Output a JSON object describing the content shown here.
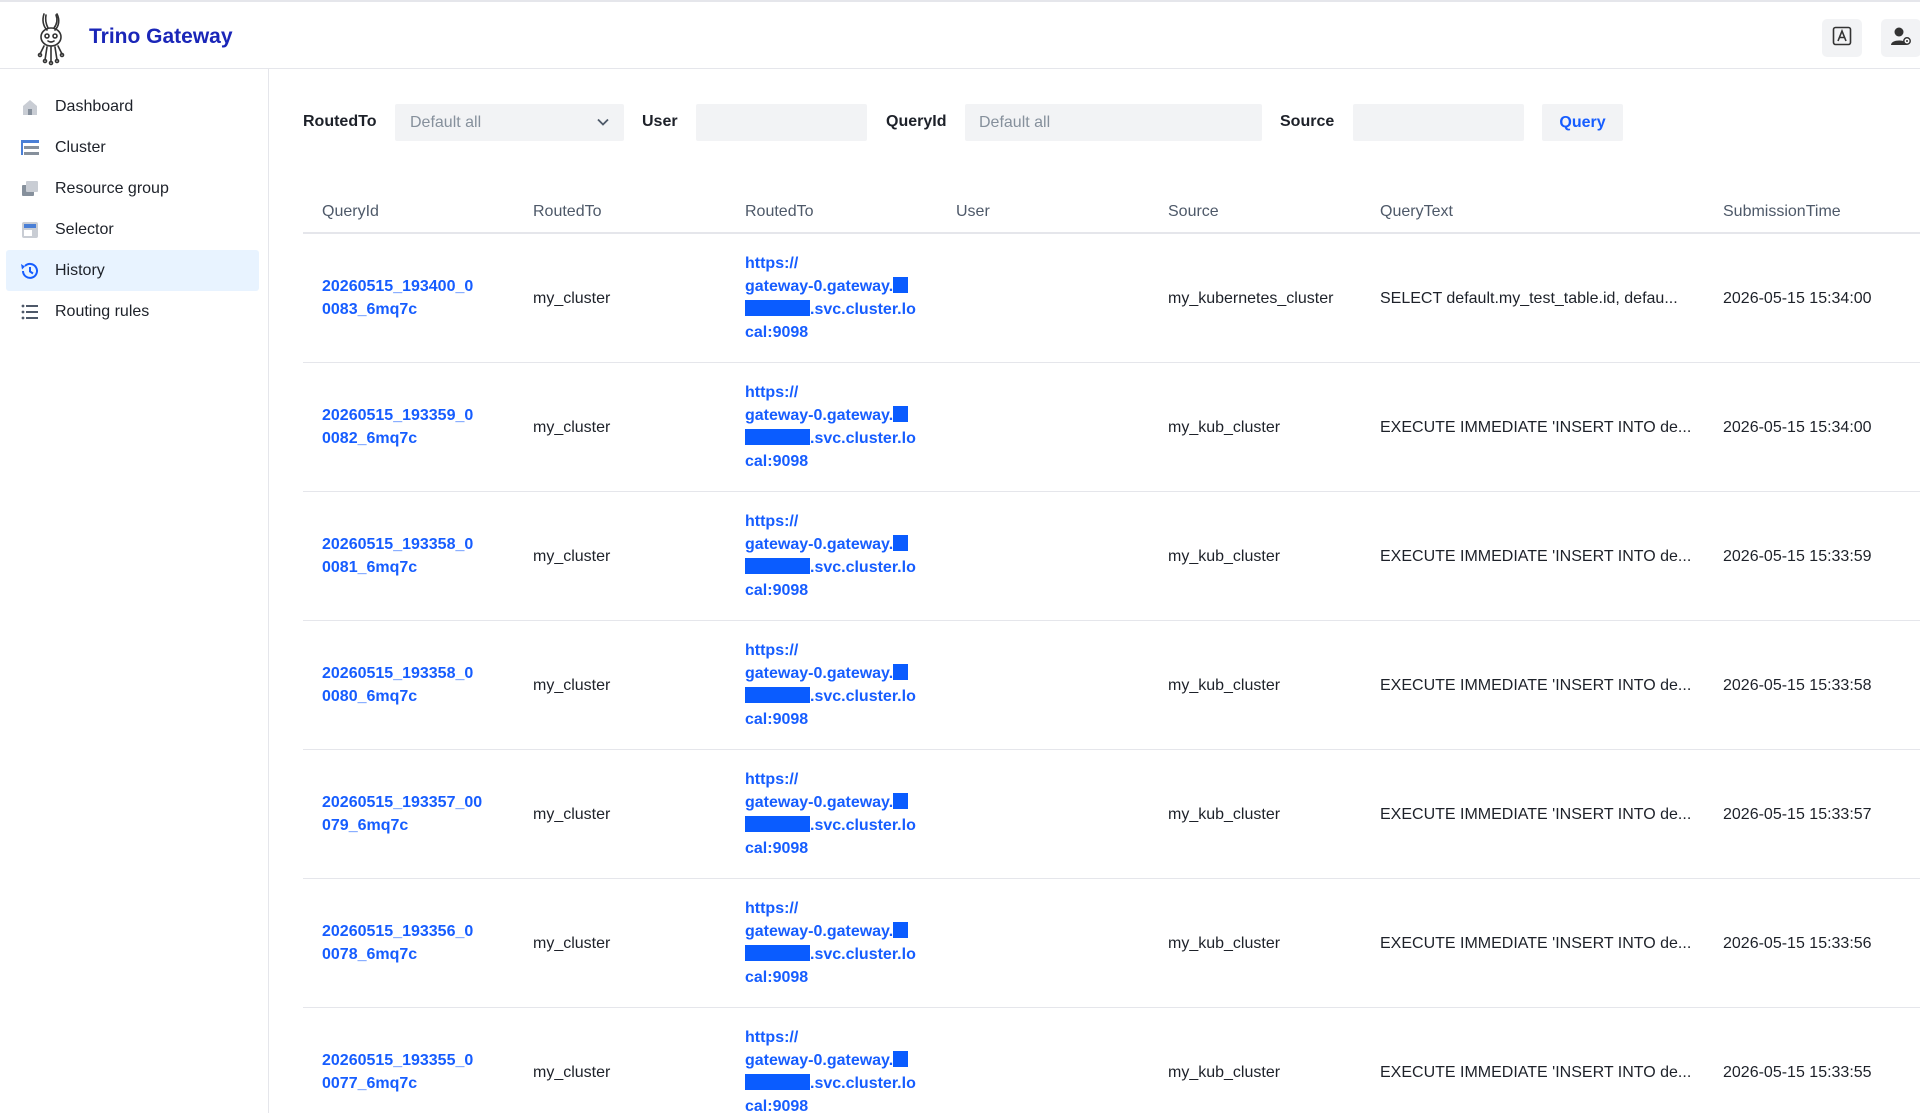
{
  "header": {
    "app_title": "Trino Gateway",
    "logo_icon": "trino-bunny-logo",
    "translate_icon": "translate-icon",
    "user_settings_icon": "user-settings-icon"
  },
  "sidebar": {
    "items": [
      {
        "label": "Dashboard",
        "icon": "home-icon",
        "active": false
      },
      {
        "label": "Cluster",
        "icon": "cluster-icon",
        "active": false
      },
      {
        "label": "Resource group",
        "icon": "resource-group-icon",
        "active": false
      },
      {
        "label": "Selector",
        "icon": "selector-icon",
        "active": false
      },
      {
        "label": "History",
        "icon": "history-icon",
        "active": true
      },
      {
        "label": "Routing rules",
        "icon": "list-icon",
        "active": false
      }
    ]
  },
  "filters": {
    "routed_to_label": "RoutedTo",
    "routed_to_placeholder": "Default all",
    "user_label": "User",
    "user_value": "",
    "query_id_label": "QueryId",
    "query_id_placeholder": "Default all",
    "source_label": "Source",
    "source_value": "",
    "query_button": "Query"
  },
  "table": {
    "columns": [
      "QueryId",
      "RoutedTo",
      "RoutedTo",
      "User",
      "Source",
      "QueryText",
      "SubmissionTime"
    ],
    "url_parts": {
      "line1": "https://",
      "line2": "gateway-0.gateway.",
      "line3_suffix": ".svc.cluster.lo",
      "line4": "cal:9098"
    },
    "rows": [
      {
        "qid1": "20260515_193400_0",
        "qid2": "0083_6mq7c",
        "cluster": "my_cluster",
        "user": "",
        "source": "my_kubernetes_cluster",
        "query_text": "SELECT default.my_test_table.id, defau...",
        "time": "2026-05-15 15:34:00"
      },
      {
        "qid1": "20260515_193359_0",
        "qid2": "0082_6mq7c",
        "cluster": "my_cluster",
        "user": "",
        "source": "my_kub_cluster",
        "query_text": "EXECUTE IMMEDIATE 'INSERT INTO de...",
        "time": "2026-05-15 15:34:00"
      },
      {
        "qid1": "20260515_193358_0",
        "qid2": "0081_6mq7c",
        "cluster": "my_cluster",
        "user": "",
        "source": "my_kub_cluster",
        "query_text": "EXECUTE IMMEDIATE 'INSERT INTO de...",
        "time": "2026-05-15 15:33:59"
      },
      {
        "qid1": "20260515_193358_0",
        "qid2": "0080_6mq7c",
        "cluster": "my_cluster",
        "user": "",
        "source": "my_kub_cluster",
        "query_text": "EXECUTE IMMEDIATE 'INSERT INTO de...",
        "time": "2026-05-15 15:33:58"
      },
      {
        "qid1": "20260515_193357_00",
        "qid2": "079_6mq7c",
        "cluster": "my_cluster",
        "user": "",
        "source": "my_kub_cluster",
        "query_text": "EXECUTE IMMEDIATE 'INSERT INTO de...",
        "time": "2026-05-15 15:33:57"
      },
      {
        "qid1": "20260515_193356_0",
        "qid2": "0078_6mq7c",
        "cluster": "my_cluster",
        "user": "",
        "source": "my_kub_cluster",
        "query_text": "EXECUTE IMMEDIATE 'INSERT INTO de...",
        "time": "2026-05-15 15:33:56"
      },
      {
        "qid1": "20260515_193355_0",
        "qid2": "0077_6mq7c",
        "cluster": "my_cluster",
        "user": "",
        "source": "my_kub_cluster",
        "query_text": "EXECUTE IMMEDIATE 'INSERT INTO de...",
        "time": "2026-05-15 15:33:55"
      }
    ]
  },
  "colors": {
    "link": "#165dff",
    "title": "#1a26b8",
    "active_bg": "#e8f3ff",
    "redaction": "#0a5cff"
  }
}
